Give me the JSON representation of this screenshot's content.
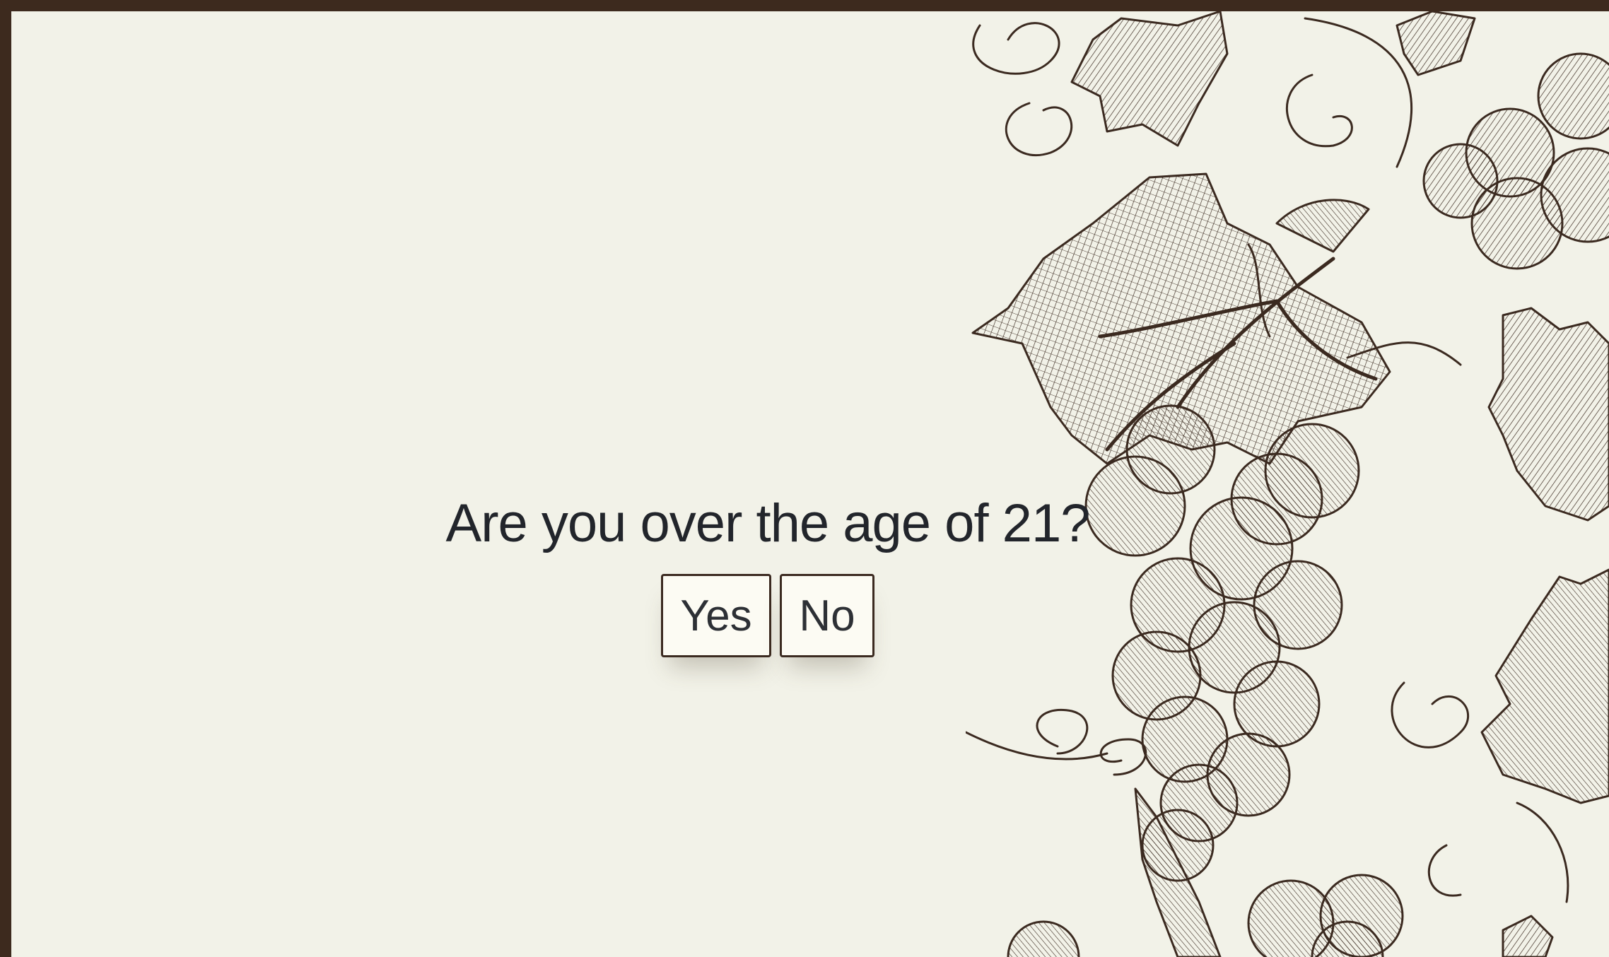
{
  "age_gate": {
    "question": "Are you over the age of 21?",
    "yes_label": "Yes",
    "no_label": "No"
  },
  "colors": {
    "border": "#3d2a1e",
    "background": "#f2f2e8",
    "text": "#22252b",
    "button_bg": "#fcfbf3",
    "ink": "#3b2a20"
  },
  "icons": [
    "grape-vine-illustration"
  ]
}
